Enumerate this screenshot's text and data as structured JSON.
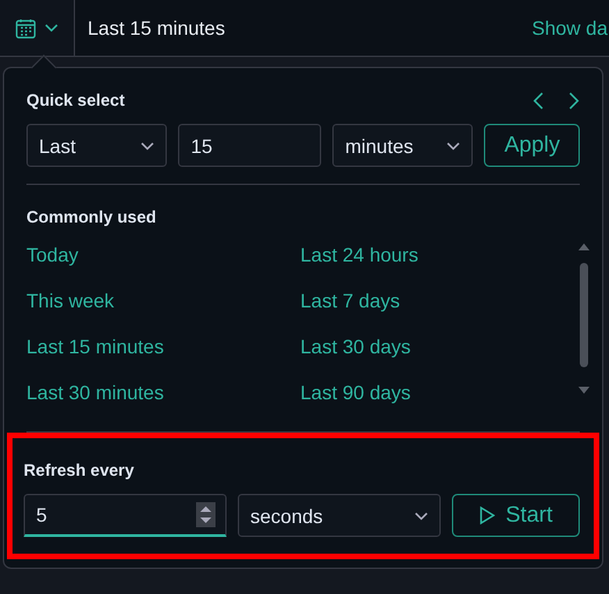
{
  "top_bar": {
    "range_label": "Last 15 minutes",
    "show_dates_link": "Show da"
  },
  "quick_select": {
    "title": "Quick select",
    "direction": "Last",
    "value": "15",
    "unit": "minutes",
    "apply_button": "Apply"
  },
  "commonly_used": {
    "title": "Commonly used",
    "items": [
      {
        "label": "Today"
      },
      {
        "label": "Last 24 hours"
      },
      {
        "label": "This week"
      },
      {
        "label": "Last 7 days"
      },
      {
        "label": "Last 15 minutes"
      },
      {
        "label": "Last 30 days"
      },
      {
        "label": "Last 30 minutes"
      },
      {
        "label": "Last 90 days"
      }
    ]
  },
  "refresh": {
    "title": "Refresh every",
    "value": "5",
    "unit": "seconds",
    "start_button": "Start",
    "highlighted": true
  }
}
